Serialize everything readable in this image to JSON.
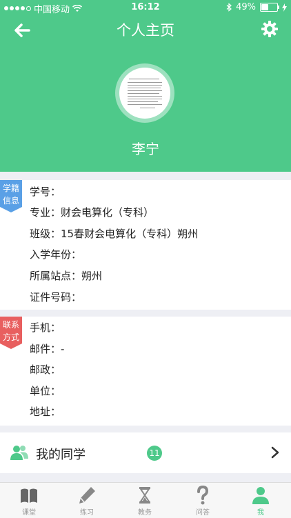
{
  "status": {
    "carrier": "中国移动",
    "time": "16:12",
    "battery": "49%",
    "battery_level": 0.49
  },
  "header": {
    "title": "个人主页",
    "name": "李宁",
    "colors": {
      "primary": "#4ec98a"
    }
  },
  "academic": {
    "tag": [
      "学籍",
      "信息"
    ],
    "rows": [
      "学号：",
      "专业：财会电算化（专科）",
      "班级：15春财会电算化（专科）朔州",
      "入学年份：",
      "所属站点：朔州",
      "证件号码："
    ]
  },
  "contact": {
    "tag": [
      "联系",
      "方式"
    ],
    "rows": [
      "手机：",
      "邮件：-",
      "邮政：",
      "单位：",
      "地址："
    ]
  },
  "classmates": {
    "label": "我的同学",
    "count": "11"
  },
  "tabs": [
    {
      "label": "课堂",
      "icon": "book-icon"
    },
    {
      "label": "练习",
      "icon": "pencil-icon"
    },
    {
      "label": "教务",
      "icon": "hourglass-icon"
    },
    {
      "label": "问答",
      "icon": "question-icon"
    },
    {
      "label": "我",
      "icon": "person-icon",
      "active": true
    }
  ],
  "colors": {
    "blue_tag": "#5aa0e6",
    "red_tag": "#e85f5f",
    "inactive_tab": "#999999"
  }
}
